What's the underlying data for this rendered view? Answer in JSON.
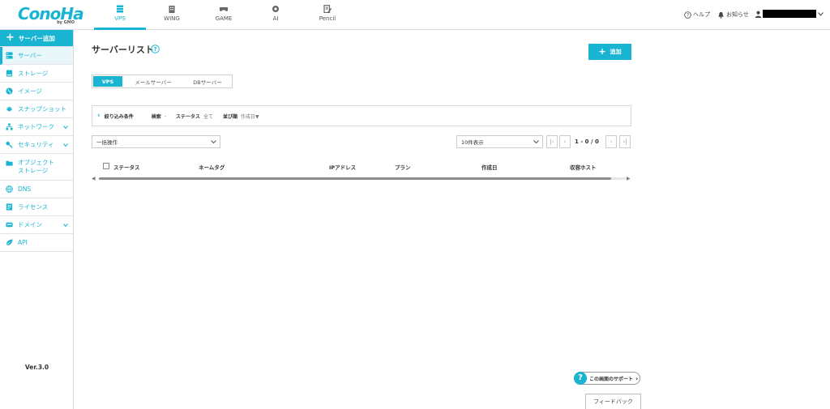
{
  "brand": {
    "logo_text": "ConoHa",
    "logo_sub": "by GMO",
    "accent": "#19b4d2"
  },
  "header": {
    "tabs": [
      {
        "label": "VPS",
        "icon": "server-stack-icon",
        "active": true
      },
      {
        "label": "WING",
        "icon": "building-icon",
        "active": false
      },
      {
        "label": "GAME",
        "icon": "gamepad-icon",
        "active": false
      },
      {
        "label": "AI",
        "icon": "ai-chip-icon",
        "active": false
      },
      {
        "label": "Pencil",
        "icon": "pencil-document-icon",
        "active": false
      }
    ],
    "help_label": "ヘルプ",
    "notice_label": "お知らせ"
  },
  "sidebar": {
    "add_label": "サーバー追加",
    "items": [
      {
        "label": "サーバー",
        "icon": "server-icon",
        "selected": true
      },
      {
        "label": "ストレージ",
        "icon": "storage-icon"
      },
      {
        "label": "イメージ",
        "icon": "image-globe-icon"
      },
      {
        "label": "スナップショット",
        "icon": "snapshot-icon"
      },
      {
        "label": "ネットワーク",
        "icon": "network-icon",
        "expandable": true
      },
      {
        "label": "セキュリティ",
        "icon": "key-icon",
        "expandable": true
      },
      {
        "label": "オブジェクト\nストレージ",
        "icon": "folder-icon"
      },
      {
        "label": "DNS",
        "icon": "globe-icon"
      },
      {
        "label": "ライセンス",
        "icon": "license-icon"
      },
      {
        "label": "ドメイン",
        "icon": "domain-icon",
        "expandable": true
      },
      {
        "label": "API",
        "icon": "leaf-icon"
      }
    ],
    "version": "Ver.3.0"
  },
  "main": {
    "title": "サーバーリスト",
    "add_button": "追加",
    "segments": [
      "VPS",
      "メールサーバー",
      "DBサーバー"
    ],
    "filter": {
      "title": "絞り込み条件",
      "search_label": "検索",
      "search_value": "-",
      "status_label": "ステータス",
      "status_value": "全て",
      "sort_label": "並び順",
      "sort_value": "作成日▼"
    },
    "bulk_action": "一括操作",
    "per_page": "10件表示",
    "pagination": "1 - 0 / 0",
    "columns": [
      "ステータス",
      "ネームタグ",
      "IPアドレス",
      "プラン",
      "作成日",
      "収容ホスト"
    ]
  },
  "support": {
    "label": "この画面のサポート"
  },
  "feedback": {
    "label": "フィードバック"
  }
}
